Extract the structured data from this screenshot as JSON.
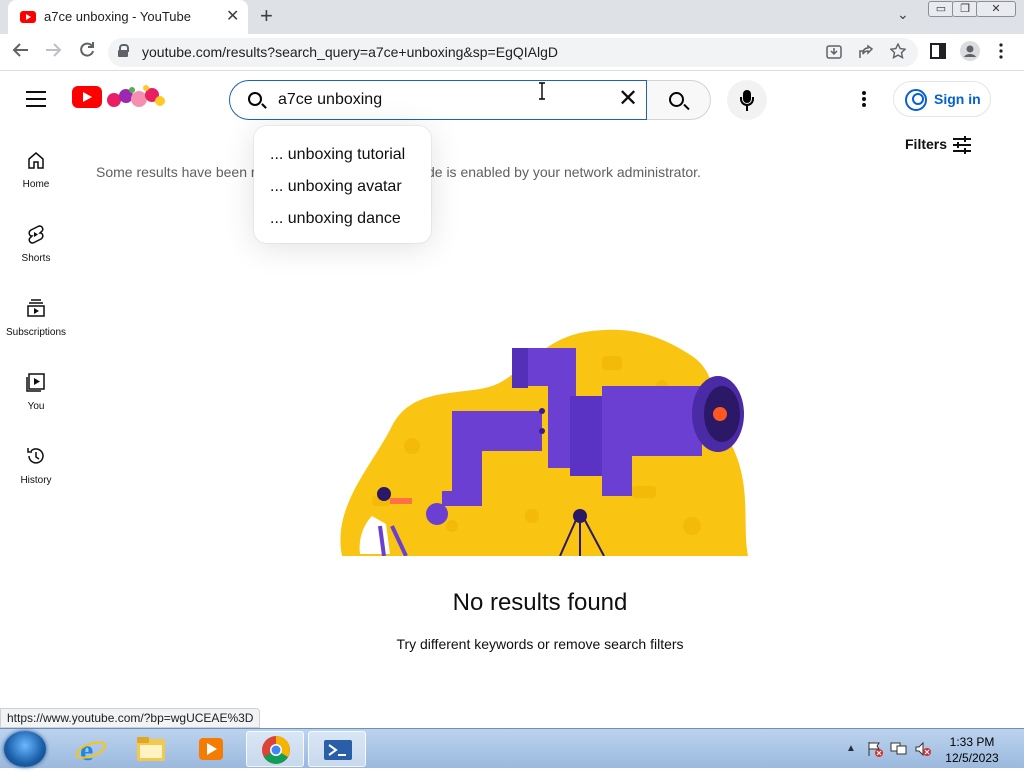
{
  "browser": {
    "tab_title": "a7ce unboxing - YouTube",
    "tab_close": "✕",
    "new_tab": "+",
    "tab_search": "⌄",
    "url": "youtube.com/results?search_query=a7ce+unboxing&sp=EgQIAlgD",
    "window_buttons": [
      "▭",
      "❐",
      "✕"
    ]
  },
  "header": {
    "search_value": "a7ce unboxing",
    "clear_symbol": "✕",
    "signin_label": "Sign in"
  },
  "suggestions": [
    "... unboxing tutorial",
    "... unboxing avatar",
    "... unboxing dance"
  ],
  "sidebar": {
    "items": [
      {
        "label": "Home"
      },
      {
        "label": "Shorts"
      },
      {
        "label": "Subscriptions"
      },
      {
        "label": "You"
      },
      {
        "label": "History"
      }
    ]
  },
  "main": {
    "notice_start": "Some results have been r",
    "notice_end": "Mode is enabled by your network administrator.",
    "filters_label": "Filters",
    "no_results_title": "No results found",
    "no_results_hint": "Try different keywords or remove search filters"
  },
  "status_bar": {
    "url": "https://www.youtube.com/?bp=wgUCEAE%3D"
  },
  "taskbar": {
    "time": "1:33 PM",
    "date": "12/5/2023"
  },
  "colors": {
    "youtube_red": "#ff0000",
    "signin_blue": "#065fd4",
    "illustration_yellow": "#f9c412",
    "illustration_purple": "#6b3fd1"
  }
}
